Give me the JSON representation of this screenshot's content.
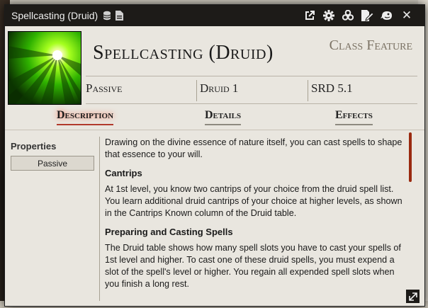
{
  "window": {
    "title": "Spellcasting (Druid)",
    "icons": [
      "database-icon",
      "document-icon",
      "external-link-icon",
      "gear-icon",
      "biohazard-icon",
      "edit-sheet-icon",
      "dragon-token-icon",
      "close-icon"
    ]
  },
  "item": {
    "name": "Spellcasting (Druid)",
    "category": "Class Feature",
    "attributes": [
      "Passive",
      "Druid 1",
      "SRD 5.1"
    ]
  },
  "tabs": [
    {
      "label": "Description",
      "active": true
    },
    {
      "label": "Details",
      "active": false
    },
    {
      "label": "Effects",
      "active": false
    }
  ],
  "sidebar": {
    "title": "Properties",
    "properties": [
      "Passive"
    ]
  },
  "description": {
    "intro": "Drawing on the divine essence of nature itself, you can cast spells to shape that essence to your will.",
    "sections": [
      {
        "heading": "Cantrips",
        "text": "At 1st level, you know two cantrips of your choice from the druid spell list. You learn additional druid cantrips of your choice at higher levels, as shown in the Cantrips Known column of the Druid table."
      },
      {
        "heading": "Preparing and Casting Spells",
        "text": "The Druid table shows how many spell slots you have to cast your spells of 1st level and higher. To cast one of these druid spells, you must expend a slot of the spell's level or higher. You regain all expended spell slots when you finish a long rest."
      }
    ]
  },
  "colors": {
    "titlebar": "#1d1b18",
    "active_tab_accent": "#b23a2c",
    "scrollbar": "#9a2a10",
    "sheet_bg": "#e9e6df"
  }
}
